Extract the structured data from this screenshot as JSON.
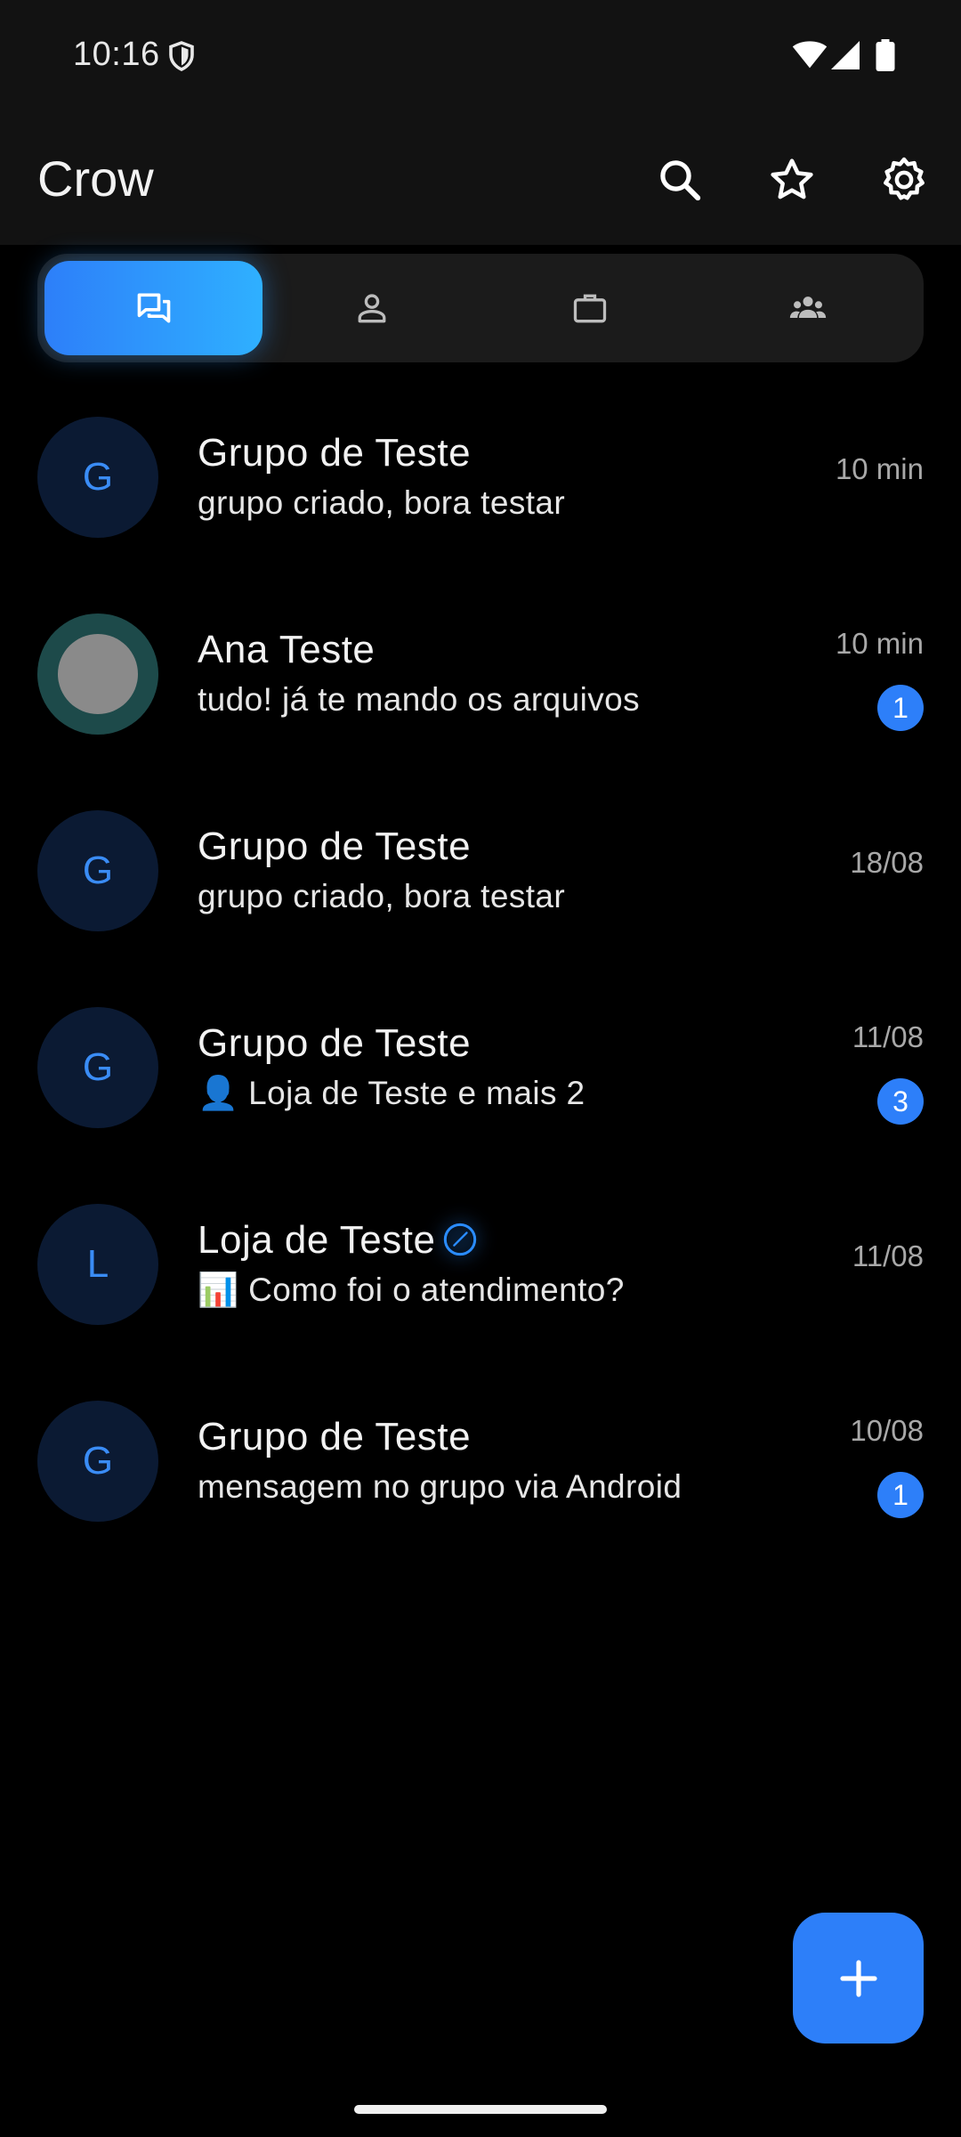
{
  "status_bar": {
    "time": "10:16"
  },
  "app_bar": {
    "title": "Crow",
    "actions": [
      "search-icon",
      "star-icon",
      "settings-icon"
    ]
  },
  "tabs": [
    {
      "icon": "chats-icon",
      "active": true
    },
    {
      "icon": "person-icon",
      "active": false
    },
    {
      "icon": "briefcase-icon",
      "active": false
    },
    {
      "icon": "groups-icon",
      "active": false
    }
  ],
  "chats": [
    {
      "initial": "G",
      "name": "Grupo de Teste",
      "preview": "grupo criado, bora testar",
      "time": "10 min",
      "unread": ""
    },
    {
      "initial": "",
      "name": "Ana Teste",
      "preview": "tudo! já te mando os arquivos",
      "time": "10 min",
      "unread": "1"
    },
    {
      "initial": "G",
      "name": "Grupo de Teste",
      "preview": "grupo criado, bora testar",
      "time": "18/08",
      "unread": ""
    },
    {
      "initial": "G",
      "name": "Grupo de Teste",
      "preview": "👤 Loja de Teste e mais 2",
      "time": "11/08",
      "unread": "3"
    },
    {
      "initial": "L",
      "name": "Loja de Teste",
      "preview": "📊 Como foi o atendimento?",
      "time": "11/08",
      "unread": ""
    },
    {
      "initial": "G",
      "name": "Grupo de Teste",
      "preview": "mensagem no grupo via Android",
      "time": "10/08",
      "unread": "1"
    }
  ],
  "colors": {
    "accent": "#2d7ff9",
    "accent_light": "#2fb0ff",
    "background": "#000000",
    "surface": "#121212",
    "avatar_bg": "#0b1a33"
  }
}
